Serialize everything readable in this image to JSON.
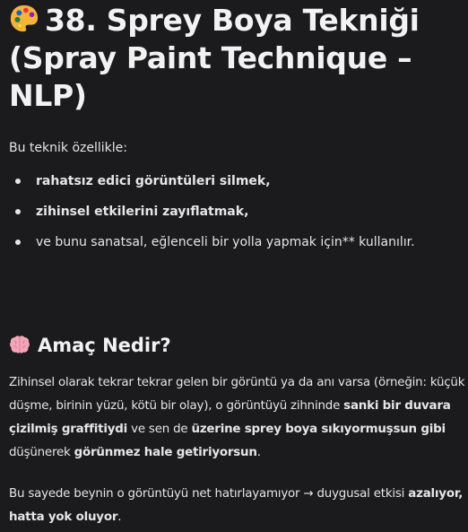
{
  "heading": {
    "icon": "artist-palette-icon",
    "text": "38. Sprey Boya Tekniği (Spray Paint Technique – NLP)"
  },
  "intro": "Bu teknik özellikle:",
  "bullets": [
    {
      "text": "rahatsız edici görüntüleri silmek,",
      "bold": true
    },
    {
      "text": "zihinsel etkilerini zayıflatmak,",
      "bold": true
    },
    {
      "text": "ve bunu sanatsal, eğlenceli bir yolla yapmak için** kullanılır.",
      "bold": false
    }
  ],
  "section": {
    "icon": "brain-icon",
    "title": "Amaç Nedir?"
  },
  "paragraph1": {
    "t1": "Zihinsel olarak tekrar tekrar gelen bir görüntü ya da anı varsa (örneğin: küçük düşme, birinin yüzü, kötü bir olay), o görüntüyü zihninde ",
    "b1": "sanki bir duvara çizilmiş graffitiydi",
    "t2": " ve sen de ",
    "b2": "üzerine sprey boya sıkıyormuşsun gibi",
    "t3": " düşünerek ",
    "b3": "görünmez hale getiriyorsun",
    "t4": "."
  },
  "paragraph2": {
    "t1": "Bu sayede beynin o görüntüyü net hatırlayamıyor → duygusal etkisi ",
    "b1": "azalıyor, hatta yok oluyor",
    "t2": "."
  }
}
